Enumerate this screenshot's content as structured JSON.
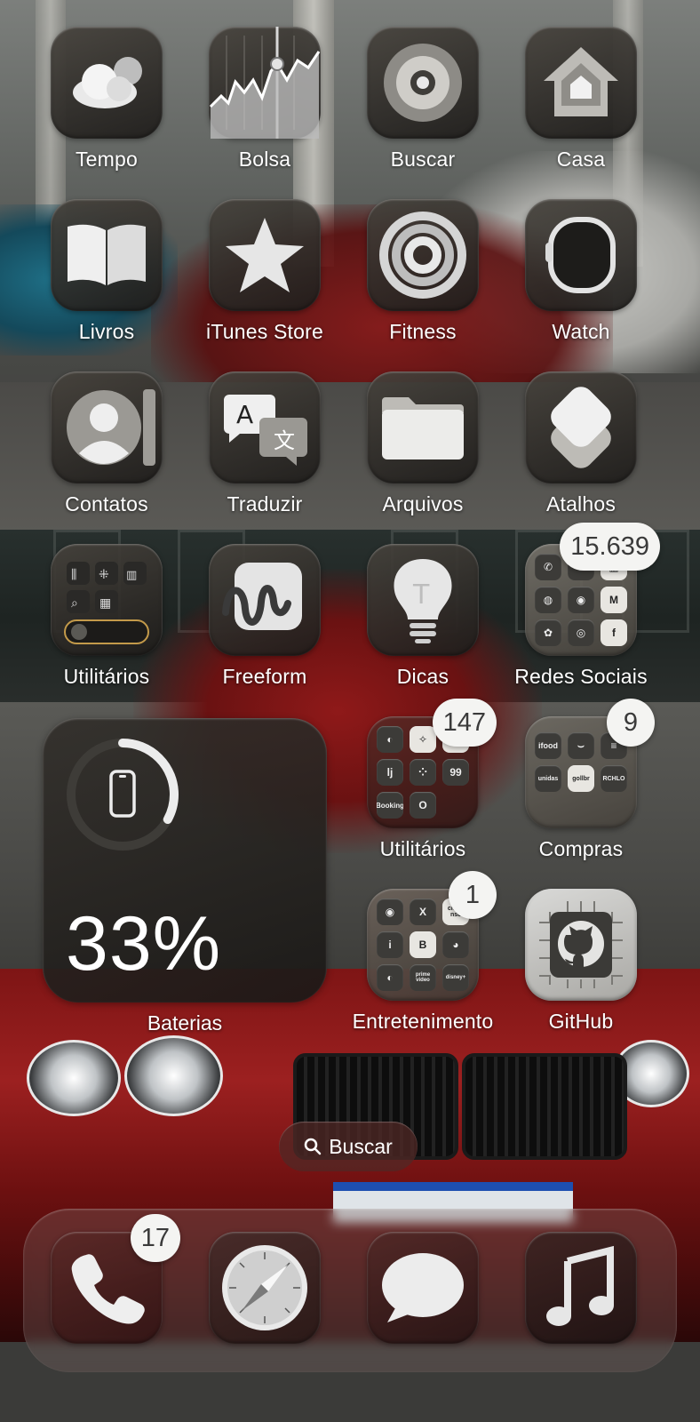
{
  "apps": {
    "tempo": {
      "label": "Tempo",
      "icon": "cloud-icon"
    },
    "bolsa": {
      "label": "Bolsa",
      "icon": "stocks-chart-icon"
    },
    "buscar": {
      "label": "Buscar",
      "icon": "find-my-icon"
    },
    "casa": {
      "label": "Casa",
      "icon": "home-icon"
    },
    "livros": {
      "label": "Livros",
      "icon": "book-icon"
    },
    "itunes": {
      "label": "iTunes Store",
      "icon": "star-icon"
    },
    "fitness": {
      "label": "Fitness",
      "icon": "activity-rings-icon"
    },
    "watch": {
      "label": "Watch",
      "icon": "watch-icon"
    },
    "contatos": {
      "label": "Contatos",
      "icon": "contact-person-icon"
    },
    "traduzir": {
      "label": "Traduzir",
      "icon": "translate-icon"
    },
    "arquivos": {
      "label": "Arquivos",
      "icon": "folder-icon"
    },
    "atalhos": {
      "label": "Atalhos",
      "icon": "shortcuts-layers-icon"
    },
    "utilitarios1": {
      "label": "Utilitários",
      "icon": "folder-grid-icon"
    },
    "freeform": {
      "label": "Freeform",
      "icon": "freeform-scribble-icon"
    },
    "dicas": {
      "label": "Dicas",
      "icon": "lightbulb-icon"
    },
    "redes": {
      "label": "Redes Sociais",
      "icon": "folder-grid-icon",
      "badge": "15.639"
    },
    "utilitarios2": {
      "label": "Utilitários",
      "icon": "folder-grid-icon",
      "badge": "147"
    },
    "compras": {
      "label": "Compras",
      "icon": "folder-grid-icon",
      "badge": "9"
    },
    "entretenimento": {
      "label": "Entretenimento",
      "icon": "folder-grid-icon",
      "badge": "1"
    },
    "github": {
      "label": "GitHub",
      "icon": "github-octocat-icon"
    }
  },
  "folders": {
    "redes": [
      "✆",
      "♪",
      "▦",
      "◍",
      "◉",
      "M",
      "✿",
      "◎",
      "f"
    ],
    "utilitarios2": [
      "◐",
      "✧",
      "▤",
      "lj",
      "⁘",
      "99",
      "Booking",
      "O",
      ""
    ],
    "compras": [
      "ifood",
      "⌣",
      "≡",
      "unidas",
      "gollbr",
      "RCHLO",
      "",
      "",
      ""
    ],
    "entretenimento": [
      "◉",
      "X",
      "clube nsc",
      "i",
      "B",
      "◕",
      "◐",
      "prime video",
      "disney+"
    ]
  },
  "widget": {
    "percent": "33%",
    "label": "Baterias",
    "level": 0.33,
    "icon": "iphone-icon"
  },
  "search": {
    "label": "Buscar",
    "icon": "magnifier-icon"
  },
  "dock": {
    "phone": {
      "icon": "phone-icon",
      "badge": "17"
    },
    "safari": {
      "icon": "compass-icon"
    },
    "messages": {
      "icon": "speech-bubble-icon"
    },
    "music": {
      "icon": "music-note-icon"
    }
  }
}
